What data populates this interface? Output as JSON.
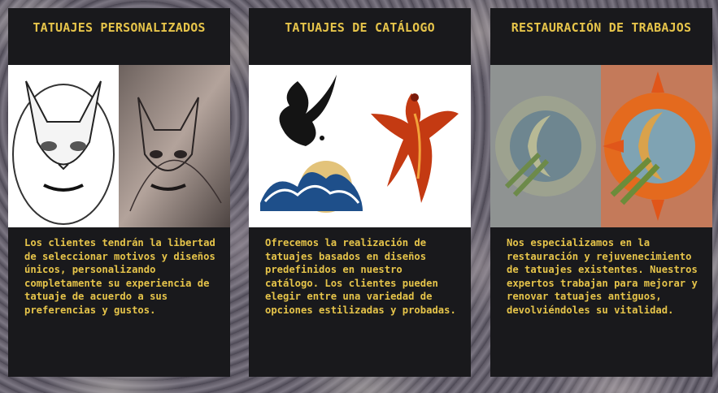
{
  "cards": [
    {
      "title": "TATUAJES PERSONALIZADOS",
      "description": "Los clientes tendrán la libertad de seleccionar motivos y diseños únicos, personalizando completamente su experiencia de tatuaje de acuerdo a sus preferencias y gustos.",
      "image_icon": "sphynx-cat-tattoo-icon"
    },
    {
      "title": "TATUAJES DE CATÁLOGO",
      "description": "Ofrecemos la realización de tatuajes basados en diseños predefinidos en nuestro catálogo. Los clientes pueden elegir entre una variedad de opciones estilizadas y probadas.",
      "image_icon": "catalog-designs-icon"
    },
    {
      "title": "RESTAURACIÓN DE TRABAJOS",
      "description": "Nos especializamos en la restauración y rejuvenecimiento de tatuajes existentes. Nuestros expertos trabajan para mejorar y renovar tatuajes antiguos, devolviéndoles su vitalidad.",
      "image_icon": "sun-moon-tattoo-icon"
    }
  ],
  "colors": {
    "card_background": "#19191c",
    "accent_text": "#e6c44a"
  }
}
